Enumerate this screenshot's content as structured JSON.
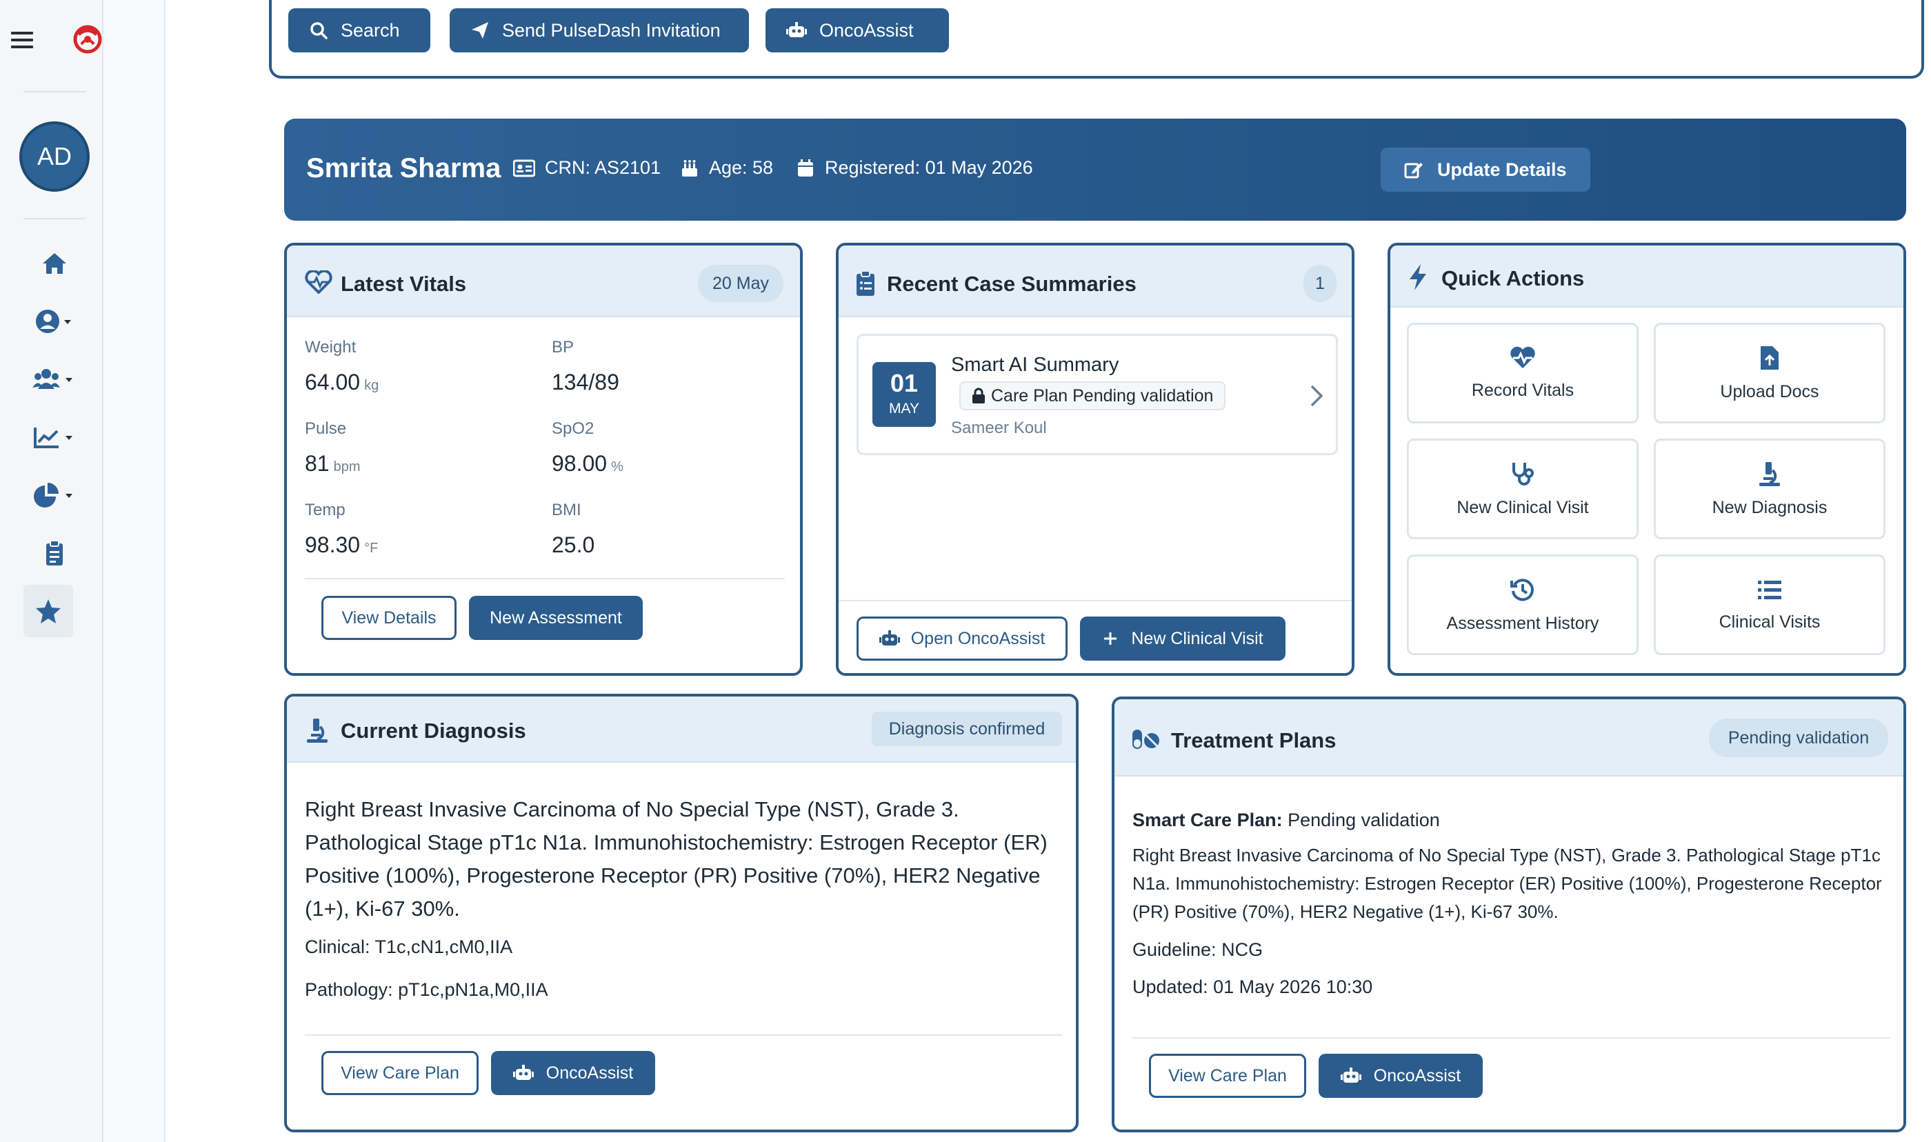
{
  "toolbar": {
    "search_label": "Search",
    "invite_label": "Send PulseDash Invitation",
    "oncoassist_label": "OncoAssist"
  },
  "sidebar": {
    "avatar_initials": "AD"
  },
  "patient": {
    "name": "Smrita Sharma",
    "crn": "CRN: AS2101",
    "age": "Age: 58",
    "registered": "Registered: 01 May 2026",
    "update_label": "Update Details"
  },
  "vitals": {
    "title": "Latest Vitals",
    "date_badge": "20 May",
    "weight_label": "Weight",
    "weight_value": "64.00",
    "weight_unit": "kg",
    "bp_label": "BP",
    "bp_value": "134/89",
    "pulse_label": "Pulse",
    "pulse_value": "81",
    "pulse_unit": "bpm",
    "spo2_label": "SpO2",
    "spo2_value": "98.00",
    "spo2_unit": "%",
    "temp_label": "Temp",
    "temp_value": "98.30",
    "temp_unit": "°F",
    "bmi_label": "BMI",
    "bmi_value": "25.0",
    "view_details_label": "View Details",
    "new_assessment_label": "New Assessment"
  },
  "case_summaries": {
    "title": "Recent Case Summaries",
    "count": "1",
    "item": {
      "day": "01",
      "month": "MAY",
      "title": "Smart AI Summary",
      "status": "Care Plan Pending validation",
      "author": "Sameer Koul"
    },
    "open_oncoassist_label": "Open OncoAssist",
    "new_visit_label": "New Clinical Visit"
  },
  "quick_actions": {
    "title": "Quick Actions",
    "tiles": [
      {
        "label": "Record Vitals",
        "icon": "heartbeat-icon"
      },
      {
        "label": "Upload Docs",
        "icon": "file-upload-icon"
      },
      {
        "label": "New Clinical Visit",
        "icon": "stethoscope-icon"
      },
      {
        "label": "New Diagnosis",
        "icon": "microscope-icon"
      },
      {
        "label": "Assessment History",
        "icon": "history-icon"
      },
      {
        "label": "Clinical Visits",
        "icon": "list-icon"
      }
    ]
  },
  "diagnosis": {
    "title": "Current Diagnosis",
    "badge": "Diagnosis confirmed",
    "text": "Right Breast Invasive Carcinoma of No Special Type (NST), Grade 3. Pathological Stage pT1c N1a. Immunohistochemistry: Estrogen Receptor (ER) Positive (100%), Progesterone Receptor (PR) Positive (70%), HER2 Negative (1+), Ki-67 30%.",
    "clinical": "Clinical: T1c,cN1,cM0,IIA",
    "pathology": "Pathology: pT1c,pN1a,M0,IIA",
    "view_care_plan_label": "View Care Plan",
    "oncoassist_label": "OncoAssist"
  },
  "treatment": {
    "title": "Treatment Plans",
    "badge": "Pending validation",
    "plan_label": "Smart Care Plan:",
    "plan_status": "Pending validation",
    "text": "Right Breast Invasive Carcinoma of No Special Type (NST), Grade 3. Pathological Stage pT1c N1a. Immunohistochemistry: Estrogen Receptor (ER) Positive (100%), Progesterone Receptor (PR) Positive (70%), HER2 Negative (1+), Ki-67 30%.",
    "guideline": "Guideline: NCG",
    "updated": "Updated: 01 May 2026 10:30",
    "view_care_plan_label": "View Care Plan",
    "oncoassist_label": "OncoAssist"
  },
  "colors": {
    "primary": "#2b5c8d",
    "header_gradient_start": "#2f6296",
    "card_head": "#e4eef6",
    "logo_red": "#d9262b"
  }
}
